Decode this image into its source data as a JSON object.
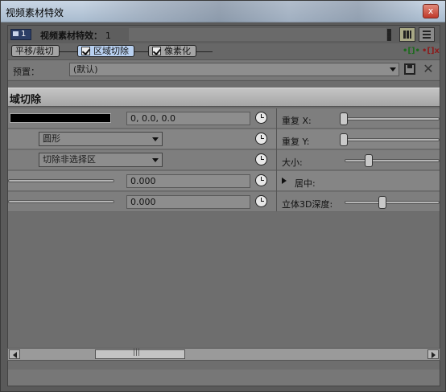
{
  "window": {
    "title": "视频素材特效",
    "close_label": "x"
  },
  "header": {
    "badge_num": "1",
    "label": "视频素材特效：",
    "count": "1"
  },
  "chain": {
    "items": [
      {
        "label": "平移/裁切"
      },
      {
        "label": "区域切除"
      },
      {
        "label": "像素化"
      }
    ]
  },
  "preset": {
    "label": "预置：",
    "value": "(默认)"
  },
  "section": {
    "title": "域切除"
  },
  "rows": [
    {
      "value": "0, 0.0, 0.0"
    },
    {
      "dropdown": "圆形"
    },
    {
      "dropdown": "切除非选择区"
    },
    {
      "value": "0.000"
    },
    {
      "value": "0.000"
    }
  ],
  "right": {
    "repeat_x": "重复 X:",
    "repeat_y": "重复 Y:",
    "size": "大小:",
    "center": "居中:",
    "depth": "立体3D深度:"
  },
  "colors": {
    "black_swatch": "#000000",
    "selected_chip": "#b8d0f0"
  }
}
